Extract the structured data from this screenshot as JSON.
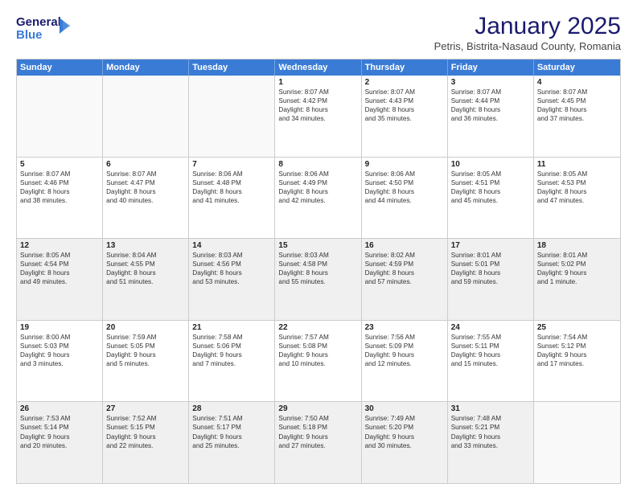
{
  "logo": {
    "line1": "General",
    "line2": "Blue"
  },
  "title": "January 2025",
  "subtitle": "Petris, Bistrita-Nasaud County, Romania",
  "days": [
    "Sunday",
    "Monday",
    "Tuesday",
    "Wednesday",
    "Thursday",
    "Friday",
    "Saturday"
  ],
  "weeks": [
    [
      {
        "num": "",
        "empty": true
      },
      {
        "num": "",
        "empty": true
      },
      {
        "num": "",
        "empty": true
      },
      {
        "num": "1",
        "lines": [
          "Sunrise: 8:07 AM",
          "Sunset: 4:42 PM",
          "Daylight: 8 hours",
          "and 34 minutes."
        ]
      },
      {
        "num": "2",
        "lines": [
          "Sunrise: 8:07 AM",
          "Sunset: 4:43 PM",
          "Daylight: 8 hours",
          "and 35 minutes."
        ]
      },
      {
        "num": "3",
        "lines": [
          "Sunrise: 8:07 AM",
          "Sunset: 4:44 PM",
          "Daylight: 8 hours",
          "and 36 minutes."
        ]
      },
      {
        "num": "4",
        "lines": [
          "Sunrise: 8:07 AM",
          "Sunset: 4:45 PM",
          "Daylight: 8 hours",
          "and 37 minutes."
        ]
      }
    ],
    [
      {
        "num": "5",
        "lines": [
          "Sunrise: 8:07 AM",
          "Sunset: 4:46 PM",
          "Daylight: 8 hours",
          "and 38 minutes."
        ]
      },
      {
        "num": "6",
        "lines": [
          "Sunrise: 8:07 AM",
          "Sunset: 4:47 PM",
          "Daylight: 8 hours",
          "and 40 minutes."
        ]
      },
      {
        "num": "7",
        "lines": [
          "Sunrise: 8:06 AM",
          "Sunset: 4:48 PM",
          "Daylight: 8 hours",
          "and 41 minutes."
        ]
      },
      {
        "num": "8",
        "lines": [
          "Sunrise: 8:06 AM",
          "Sunset: 4:49 PM",
          "Daylight: 8 hours",
          "and 42 minutes."
        ]
      },
      {
        "num": "9",
        "lines": [
          "Sunrise: 8:06 AM",
          "Sunset: 4:50 PM",
          "Daylight: 8 hours",
          "and 44 minutes."
        ]
      },
      {
        "num": "10",
        "lines": [
          "Sunrise: 8:05 AM",
          "Sunset: 4:51 PM",
          "Daylight: 8 hours",
          "and 45 minutes."
        ]
      },
      {
        "num": "11",
        "lines": [
          "Sunrise: 8:05 AM",
          "Sunset: 4:53 PM",
          "Daylight: 8 hours",
          "and 47 minutes."
        ]
      }
    ],
    [
      {
        "num": "12",
        "shaded": true,
        "lines": [
          "Sunrise: 8:05 AM",
          "Sunset: 4:54 PM",
          "Daylight: 8 hours",
          "and 49 minutes."
        ]
      },
      {
        "num": "13",
        "shaded": true,
        "lines": [
          "Sunrise: 8:04 AM",
          "Sunset: 4:55 PM",
          "Daylight: 8 hours",
          "and 51 minutes."
        ]
      },
      {
        "num": "14",
        "shaded": true,
        "lines": [
          "Sunrise: 8:03 AM",
          "Sunset: 4:56 PM",
          "Daylight: 8 hours",
          "and 53 minutes."
        ]
      },
      {
        "num": "15",
        "shaded": true,
        "lines": [
          "Sunrise: 8:03 AM",
          "Sunset: 4:58 PM",
          "Daylight: 8 hours",
          "and 55 minutes."
        ]
      },
      {
        "num": "16",
        "shaded": true,
        "lines": [
          "Sunrise: 8:02 AM",
          "Sunset: 4:59 PM",
          "Daylight: 8 hours",
          "and 57 minutes."
        ]
      },
      {
        "num": "17",
        "shaded": true,
        "lines": [
          "Sunrise: 8:01 AM",
          "Sunset: 5:01 PM",
          "Daylight: 8 hours",
          "and 59 minutes."
        ]
      },
      {
        "num": "18",
        "shaded": true,
        "lines": [
          "Sunrise: 8:01 AM",
          "Sunset: 5:02 PM",
          "Daylight: 9 hours",
          "and 1 minute."
        ]
      }
    ],
    [
      {
        "num": "19",
        "lines": [
          "Sunrise: 8:00 AM",
          "Sunset: 5:03 PM",
          "Daylight: 9 hours",
          "and 3 minutes."
        ]
      },
      {
        "num": "20",
        "lines": [
          "Sunrise: 7:59 AM",
          "Sunset: 5:05 PM",
          "Daylight: 9 hours",
          "and 5 minutes."
        ]
      },
      {
        "num": "21",
        "lines": [
          "Sunrise: 7:58 AM",
          "Sunset: 5:06 PM",
          "Daylight: 9 hours",
          "and 7 minutes."
        ]
      },
      {
        "num": "22",
        "lines": [
          "Sunrise: 7:57 AM",
          "Sunset: 5:08 PM",
          "Daylight: 9 hours",
          "and 10 minutes."
        ]
      },
      {
        "num": "23",
        "lines": [
          "Sunrise: 7:56 AM",
          "Sunset: 5:09 PM",
          "Daylight: 9 hours",
          "and 12 minutes."
        ]
      },
      {
        "num": "24",
        "lines": [
          "Sunrise: 7:55 AM",
          "Sunset: 5:11 PM",
          "Daylight: 9 hours",
          "and 15 minutes."
        ]
      },
      {
        "num": "25",
        "lines": [
          "Sunrise: 7:54 AM",
          "Sunset: 5:12 PM",
          "Daylight: 9 hours",
          "and 17 minutes."
        ]
      }
    ],
    [
      {
        "num": "26",
        "shaded": true,
        "lines": [
          "Sunrise: 7:53 AM",
          "Sunset: 5:14 PM",
          "Daylight: 9 hours",
          "and 20 minutes."
        ]
      },
      {
        "num": "27",
        "shaded": true,
        "lines": [
          "Sunrise: 7:52 AM",
          "Sunset: 5:15 PM",
          "Daylight: 9 hours",
          "and 22 minutes."
        ]
      },
      {
        "num": "28",
        "shaded": true,
        "lines": [
          "Sunrise: 7:51 AM",
          "Sunset: 5:17 PM",
          "Daylight: 9 hours",
          "and 25 minutes."
        ]
      },
      {
        "num": "29",
        "shaded": true,
        "lines": [
          "Sunrise: 7:50 AM",
          "Sunset: 5:18 PM",
          "Daylight: 9 hours",
          "and 27 minutes."
        ]
      },
      {
        "num": "30",
        "shaded": true,
        "lines": [
          "Sunrise: 7:49 AM",
          "Sunset: 5:20 PM",
          "Daylight: 9 hours",
          "and 30 minutes."
        ]
      },
      {
        "num": "31",
        "shaded": true,
        "lines": [
          "Sunrise: 7:48 AM",
          "Sunset: 5:21 PM",
          "Daylight: 9 hours",
          "and 33 minutes."
        ]
      },
      {
        "num": "",
        "empty": true
      }
    ]
  ]
}
